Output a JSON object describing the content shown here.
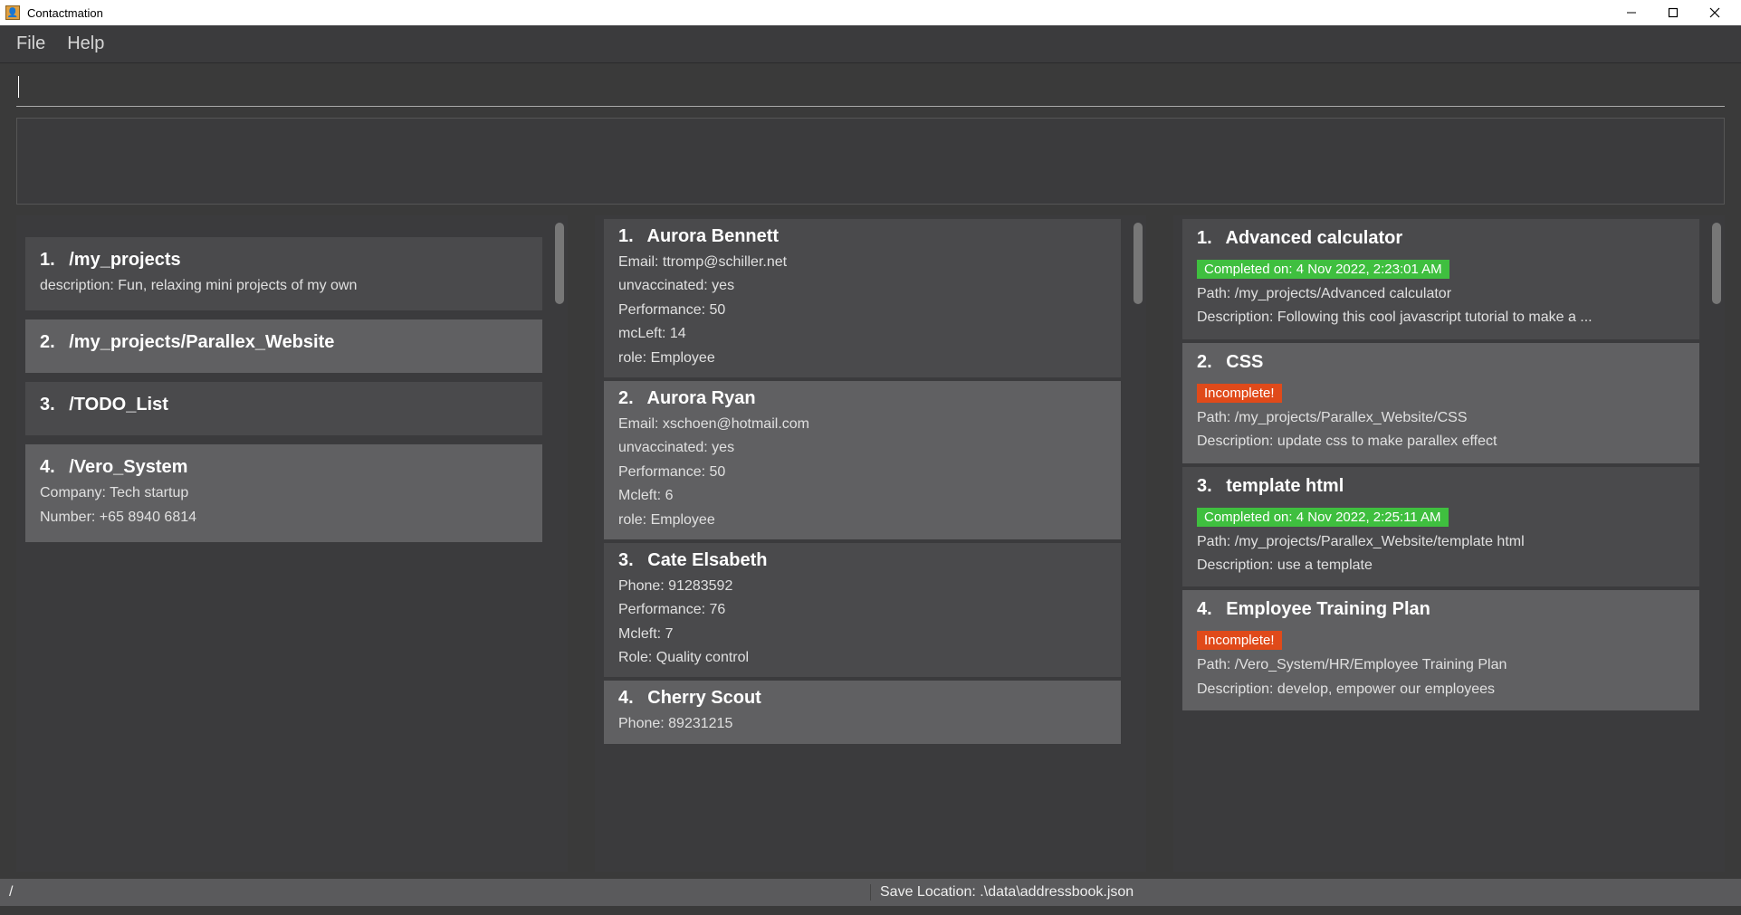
{
  "app": {
    "title": "Contactmation"
  },
  "menu": {
    "file": "File",
    "help": "Help"
  },
  "command": {
    "value": "",
    "placeholder": ""
  },
  "statusbar": {
    "left": "/",
    "right": "Save Location: .\\data\\addressbook.json"
  },
  "projects": [
    {
      "idx": "1.",
      "title": "/my_projects",
      "lines": [
        "description: Fun, relaxing mini projects of my own"
      ]
    },
    {
      "idx": "2.",
      "title": "/my_projects/Parallex_Website",
      "lines": []
    },
    {
      "idx": "3.",
      "title": "/TODO_List",
      "lines": []
    },
    {
      "idx": "4.",
      "title": "/Vero_System",
      "lines": [
        "Company: Tech startup",
        "Number: +65 8940 6814"
      ]
    }
  ],
  "people": [
    {
      "idx": "1.",
      "title": "Aurora Bennett",
      "lines": [
        "Email: ttromp@schiller.net",
        "unvaccinated: yes",
        "Performance: 50",
        "mcLeft: 14",
        "role: Employee"
      ]
    },
    {
      "idx": "2.",
      "title": "Aurora Ryan",
      "lines": [
        "Email: xschoen@hotmail.com",
        "unvaccinated: yes",
        "Performance: 50",
        "Mcleft: 6",
        "role: Employee"
      ]
    },
    {
      "idx": "3.",
      "title": "Cate Elsabeth",
      "lines": [
        "Phone: 91283592",
        "Performance: 76",
        "Mcleft: 7",
        "Role: Quality control"
      ]
    },
    {
      "idx": "4.",
      "title": "Cherry Scout",
      "lines": [
        "Phone: 89231215"
      ]
    }
  ],
  "tasks": [
    {
      "idx": "1.",
      "title": "Advanced calculator",
      "badge": {
        "text": "Completed on: 4 Nov 2022, 2:23:01 AM",
        "kind": "green"
      },
      "lines": [
        "Path: /my_projects/Advanced calculator",
        "Description: Following this cool javascript tutorial to make a ..."
      ]
    },
    {
      "idx": "2.",
      "title": "CSS",
      "badge": {
        "text": "Incomplete!",
        "kind": "red"
      },
      "lines": [
        "Path: /my_projects/Parallex_Website/CSS",
        "Description: update css to make parallex effect"
      ]
    },
    {
      "idx": "3.",
      "title": "template html",
      "badge": {
        "text": "Completed on: 4 Nov 2022, 2:25:11 AM",
        "kind": "green"
      },
      "lines": [
        "Path: /my_projects/Parallex_Website/template html",
        "Description: use a template"
      ]
    },
    {
      "idx": "4.",
      "title": "Employee Training Plan",
      "badge": {
        "text": "Incomplete!",
        "kind": "red"
      },
      "lines": [
        "Path: /Vero_System/HR/Employee Training Plan",
        "Description: develop, empower our employees"
      ]
    }
  ]
}
